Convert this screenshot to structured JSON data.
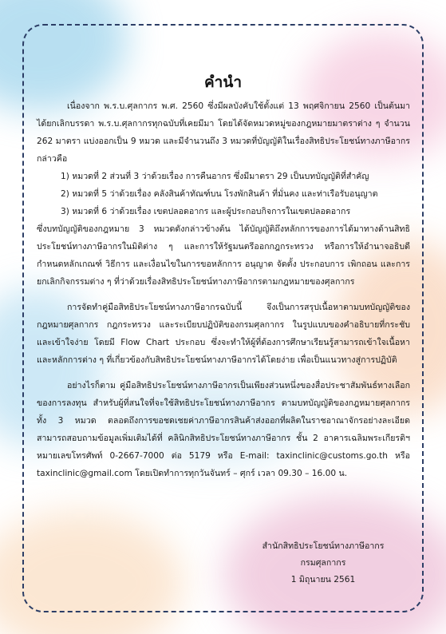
{
  "title": "คำนำ",
  "paragraph1": "เนื่องจาก พ.ร.บ.ศุลกากร พ.ศ. 2560 ซึ่งมีผลบังคับใช้ตั้งแต่ 13 พฤศจิกายน 2560 เป็นต้นมา ได้ยกเลิกบรรดา พ.ร.บ.ศุลกากรทุกฉบับที่เคยมีมา โดยได้จัดหมวดหมู่ของกฎหมายมาตราต่าง ๆ จำนวน 262 มาตรา แบ่งออกเป็น 9 หมวด และมีจำนวนถึง 3 หมวดที่บัญญัติในเรื่องสิทธิประโยชน์ทางภาษีอากร กล่าวคือ",
  "list_items": [
    "1)  หมวดที่ 2 ส่วนที่ 3 ว่าด้วยเรื่อง การคืนอากร ซึ่งมีมาตรา 29 เป็นบทบัญญัติที่สำคัญ",
    "2)  หมวดที่ 5 ว่าด้วยเรื่อง คลังสินค้าทัณฑ์บน โรงพักสินค้า ที่มั่นคง และท่าเรือรับอนุญาต",
    "3)  หมวดที่ 6 ว่าด้วยเรื่อง เขตปลอดอากร และผู้ประกอบกิจการในเขตปลอดอากร"
  ],
  "paragraph2": "ซึ่งบทบัญญัติของกฎหมาย 3 หมวดดังกล่าวข้างต้น ได้บัญญัติถึงหลักการของการได้มาทางด้านสิทธิประโยชน์ทางภาษีอากรในมิติต่าง ๆ และการให้รัฐมนตรีออกกฎกระทรวง หรือการให้อำนาจอธิบดี กำหนดหลักเกณฑ์ วิธีการ และเงื่อนไขในการขอหลักการ อนุญาต จัดตั้ง ประกอบการ เพิกถอน และการยกเลิกกิจกรรมต่าง ๆ ที่ว่าด้วยเรื่องสิทธิประโยชน์ทางภาษีอากรตามกฎหมายของศุลกากร",
  "paragraph3": "การจัดทำคู่มือสิทธิประโยชน์ทางภาษีอากรฉบับนี้ จึงเป็นการสรุปเนื้อหาตามบทบัญญัติของกฎหมายศุลกากร กฎกระทรวง และระเบียบปฏิบัติของกรมศุลกากร ในรูปแบบของคำอธิบายที่กระชับ และเข้าใจง่าย โดยมี Flow Chart ประกอบ ซึ่งจะทำให้ผู้ที่ต้องการศึกษาเรียนรู้สามารถเข้าใจเนื้อหา และหลักการต่าง ๆ ที่เกี่ยวข้องกับสิทธิประโยชน์ทางภาษีอากรได้โดยง่าย เพื่อเป็นแนวทางสู่การปฏิบัติ",
  "paragraph4": "อย่างไรก็ตาม คู่มือสิทธิประโยชน์ทางภาษีอากรเป็นเพียงส่วนหนึ่งของสื่อประชาสัมพันธ์ทางเลือกของการลงทุน สำหรับผู้ที่สนใจที่จะใช้สิทธิประโยชน์ทางภาษีอากร ตามบทบัญญัติของกฎหมายศุลกากรทั้ง 3 หมวด ตลอดถึงการขอชดเชยค่าภาษีอากรสินค้าส่งออกที่ผลิตในราชอาณาจักรอย่างละเอียด สามารถสอบถามข้อมูลเพิ่มเติมได้ที่ คลินิกสิทธิประโยชน์ทางภาษีอากร ชั้น 2 อาคารเฉลิมพระเกียรติฯ หมายเลขโทรศัพท์ 0-2667-7000 ต่อ 5179 หรือ E-mail: taxinclinic@customs.go.th หรือ taxinclinic@gmail.com โดยเปิดทำการทุกวันจันทร์ – ศุกร์ เวลา 09.30 – 16.00 น.",
  "signature": {
    "office": "สำนักสิทธิประโยชน์ทางภาษีอากร",
    "department": "กรมศุลกากร",
    "date": "1 มิถุนายน 2561"
  }
}
